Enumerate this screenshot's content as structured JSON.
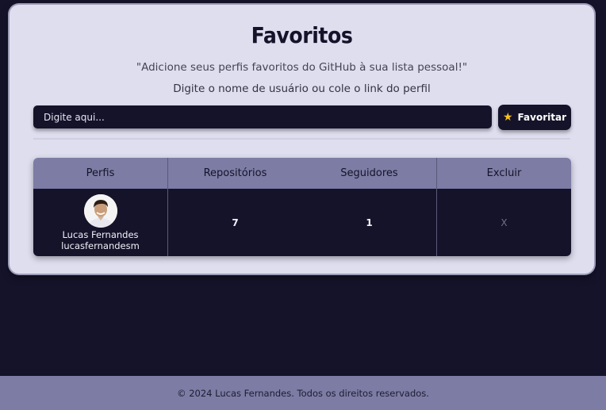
{
  "header": {
    "title": "Favoritos",
    "subtitle": "\"Adicione seus perfis favoritos do GitHub à sua lista pessoal!\"",
    "hint": "Digite o nome de usuário ou cole o link do perfil"
  },
  "search": {
    "placeholder": "Digite aqui...",
    "value": ""
  },
  "favorite_button": {
    "icon": "star-icon",
    "label": "Favoritar"
  },
  "table": {
    "headers": [
      "Perfis",
      "Repositórios",
      "Seguidores",
      "Excluir"
    ],
    "rows": [
      {
        "name": "Lucas Fernandes",
        "login": "lucasfernandesm",
        "repositories": "7",
        "followers": "1",
        "delete_label": "X"
      }
    ]
  },
  "footer": {
    "text": "© 2024 Lucas Fernandes. Todos os direitos reservados."
  },
  "colors": {
    "background": "#15132a",
    "card": "#dedeef",
    "accent": "#7c7ca4",
    "star": "#f7c21b"
  }
}
